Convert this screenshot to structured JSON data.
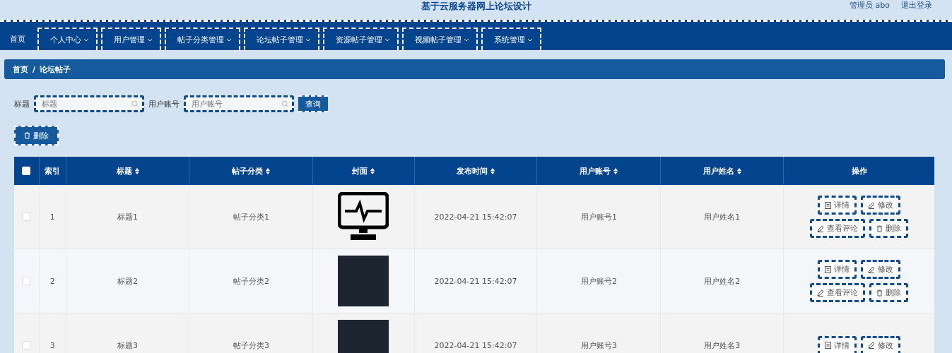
{
  "header": {
    "title": "基于云服务器网上论坛设计",
    "user": "管理员 abo",
    "logout": "退出登录"
  },
  "nav": [
    {
      "label": "首页",
      "dropdown": false
    },
    {
      "label": "个人中心",
      "dropdown": true
    },
    {
      "label": "用户管理",
      "dropdown": true
    },
    {
      "label": "帖子分类管理",
      "dropdown": true
    },
    {
      "label": "论坛帖子管理",
      "dropdown": true
    },
    {
      "label": "资源帖子管理",
      "dropdown": true
    },
    {
      "label": "视频帖子管理",
      "dropdown": true
    },
    {
      "label": "系统管理",
      "dropdown": true
    }
  ],
  "breadcrumb": {
    "items": [
      "首页",
      "论坛帖子"
    ],
    "separator": "/"
  },
  "search": {
    "fields": [
      {
        "label": "标题",
        "placeholder": "标题"
      },
      {
        "label": "用户账号",
        "placeholder": "用户账号"
      }
    ],
    "button": "查询"
  },
  "delete_button": "删除",
  "table": {
    "select_all": {
      "checked": false
    },
    "columns": [
      {
        "label": "索引",
        "sortable": false
      },
      {
        "label": "标题",
        "sortable": true
      },
      {
        "label": "帖子分类",
        "sortable": true
      },
      {
        "label": "封面",
        "sortable": true
      },
      {
        "label": "发布时间",
        "sortable": true
      },
      {
        "label": "用户账号",
        "sortable": true
      },
      {
        "label": "用户姓名",
        "sortable": true
      },
      {
        "label": "操作",
        "sortable": false
      }
    ],
    "rows": [
      {
        "checked": false,
        "index": "1",
        "title": "标题1",
        "category": "帖子分类1",
        "cover": {
          "kind": "icon"
        },
        "time": "2022-04-21 15:42:07",
        "account": "用户账号1",
        "name": "用户姓名1",
        "actions": [
          {
            "kind": "detail",
            "label": "详情"
          },
          {
            "kind": "edit",
            "label": "修改"
          },
          {
            "kind": "comments",
            "label": "查看评论"
          },
          {
            "kind": "delete",
            "label": "删除"
          }
        ]
      },
      {
        "checked": false,
        "index": "2",
        "title": "标题2",
        "category": "帖子分类2",
        "cover": {
          "kind": "photo"
        },
        "time": "2022-04-21 15:42:07",
        "account": "用户账号2",
        "name": "用户姓名2",
        "actions": [
          {
            "kind": "detail",
            "label": "详情"
          },
          {
            "kind": "edit",
            "label": "修改"
          },
          {
            "kind": "comments",
            "label": "查看评论"
          },
          {
            "kind": "delete",
            "label": "删除"
          }
        ]
      },
      {
        "checked": false,
        "index": "3",
        "title": "标题3",
        "category": "帖子分类3",
        "cover": {
          "kind": "photo"
        },
        "time": "2022-04-21 15:42:07",
        "account": "用户账号3",
        "name": "用户姓名3",
        "actions": [
          {
            "kind": "detail",
            "label": "详情"
          },
          {
            "kind": "edit",
            "label": "修改"
          }
        ]
      }
    ]
  }
}
